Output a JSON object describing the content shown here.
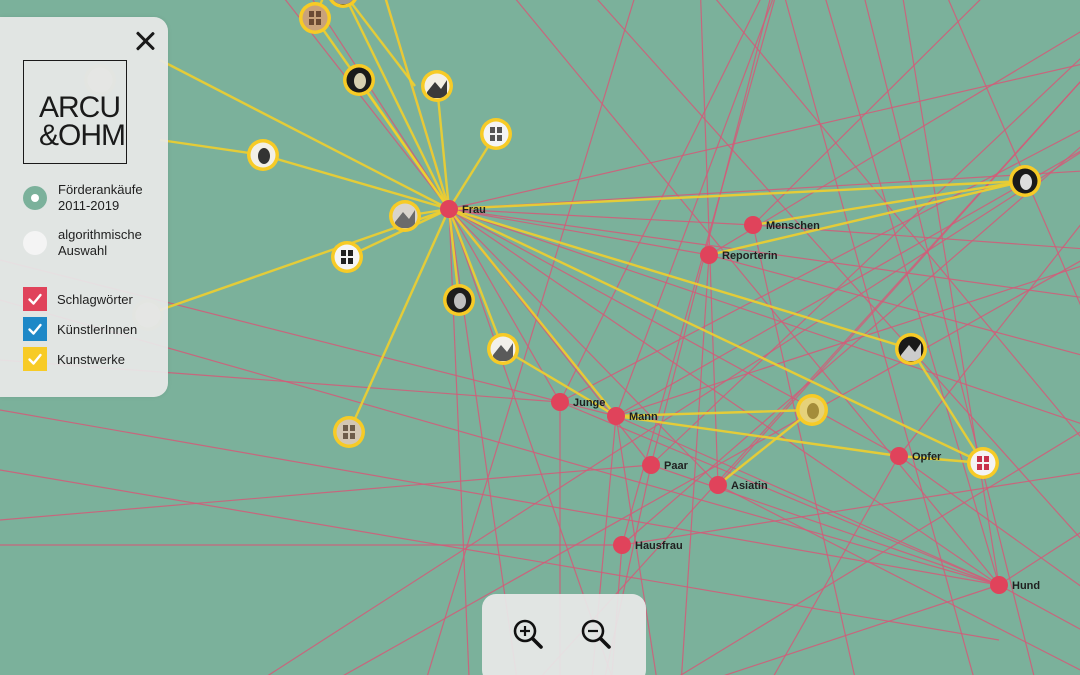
{
  "panel": {
    "logo": {
      "line1": "ARCU",
      "line2": "&OHM"
    },
    "datasets": [
      {
        "label": "Förderankäufe\n2011-2019",
        "selected": true
      },
      {
        "label": "algorithmische\nAuswahl",
        "selected": false
      }
    ],
    "filters": [
      {
        "label": "Schlagwörter",
        "checked": true,
        "color": "#e0435b"
      },
      {
        "label": "KünstlerInnen",
        "checked": true,
        "color": "#1e88c7"
      },
      {
        "label": "Kunstwerke",
        "checked": true,
        "color": "#f7cb26"
      }
    ]
  },
  "zoom": {
    "in_icon": "zoom-in-icon",
    "out_icon": "zoom-out-icon"
  },
  "colors": {
    "background": "#7bb19b",
    "keyword_node": "#e0435b",
    "keyword_edge": "#d45a78",
    "artwork_edge": "#f0cf2e",
    "artwork_ring": "#f7cb26"
  },
  "graph": {
    "keywords": [
      "Frau",
      "Menschen",
      "Reporterin",
      "Junge",
      "Mann",
      "Paar",
      "Asiatin",
      "Opfer",
      "Hausfrau",
      "Hund"
    ],
    "artworks": [
      "artwork-1",
      "artwork-2",
      "artwork-3",
      "artwork-4",
      "artwork-5",
      "artwork-6",
      "artwork-7",
      "artwork-8",
      "artwork-9",
      "artwork-10",
      "artwork-11",
      "artwork-12",
      "artwork-13",
      "artwork-14",
      "artwork-15",
      "artwork-16",
      "artwork-17"
    ]
  }
}
